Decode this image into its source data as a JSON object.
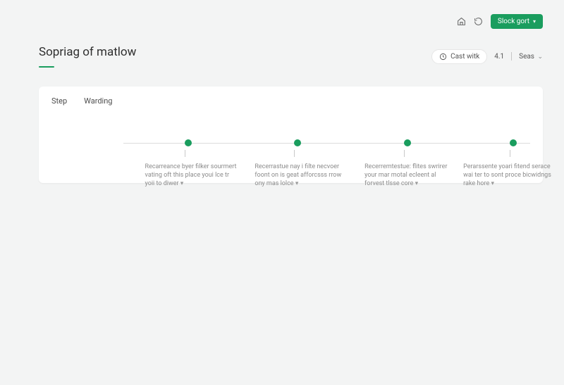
{
  "topbar": {
    "icons": {
      "home": "home-icon",
      "refresh": "refresh-icon"
    },
    "primary_label": "Slock gort",
    "primary_has_chevron": true
  },
  "header": {
    "title": "Sopriag of matlow",
    "actions": {
      "cast_label": "Cast witk",
      "version": "4.1",
      "select_label": "Seas"
    }
  },
  "tabs": [
    {
      "label": "Step"
    },
    {
      "label": "Warding"
    }
  ],
  "timeline": {
    "steps": [
      {
        "text": "Recarreance byer filker sourmert vating oft this place youi lce tr yoii to diwer",
        "more": "▾"
      },
      {
        "text": "Recerrastue nay i filte necvoer foont on is geat afforcsss rrow ony mas lolce",
        "more": "▾"
      },
      {
        "text": "Recerremtestue: flites swrirer your mar motal ecleent al forvest tlsse core",
        "more": "▾"
      },
      {
        "text": "Perarssente yoari fitend serace wai ter to sont proce bicwidngs rake hore",
        "more": "▾"
      }
    ]
  },
  "colors": {
    "accent": "#1a9d5e"
  }
}
